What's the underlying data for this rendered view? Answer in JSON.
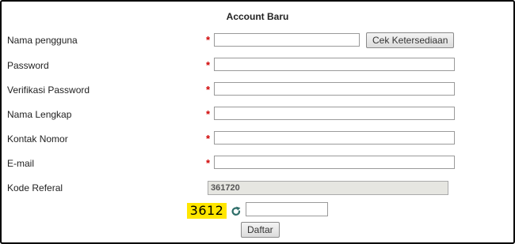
{
  "form": {
    "title": "Account Baru",
    "required_mark": "*",
    "fields": [
      {
        "label": "Nama pengguna",
        "value": ""
      },
      {
        "label": "Password",
        "value": ""
      },
      {
        "label": "Verifikasi Password",
        "value": ""
      },
      {
        "label": "Nama Lengkap",
        "value": ""
      },
      {
        "label": "Kontak Nomor",
        "value": ""
      },
      {
        "label": "E-mail",
        "value": ""
      }
    ],
    "check_button": "Cek Ketersediaan",
    "referral": {
      "label": "Kode Referal",
      "value": "361720"
    },
    "captcha": {
      "code": "3612",
      "input_value": ""
    },
    "submit": "Daftar"
  },
  "colors": {
    "required": "#d00000",
    "captcha_bg": "#ffe600"
  },
  "icons": {
    "refresh": "refresh-icon"
  }
}
